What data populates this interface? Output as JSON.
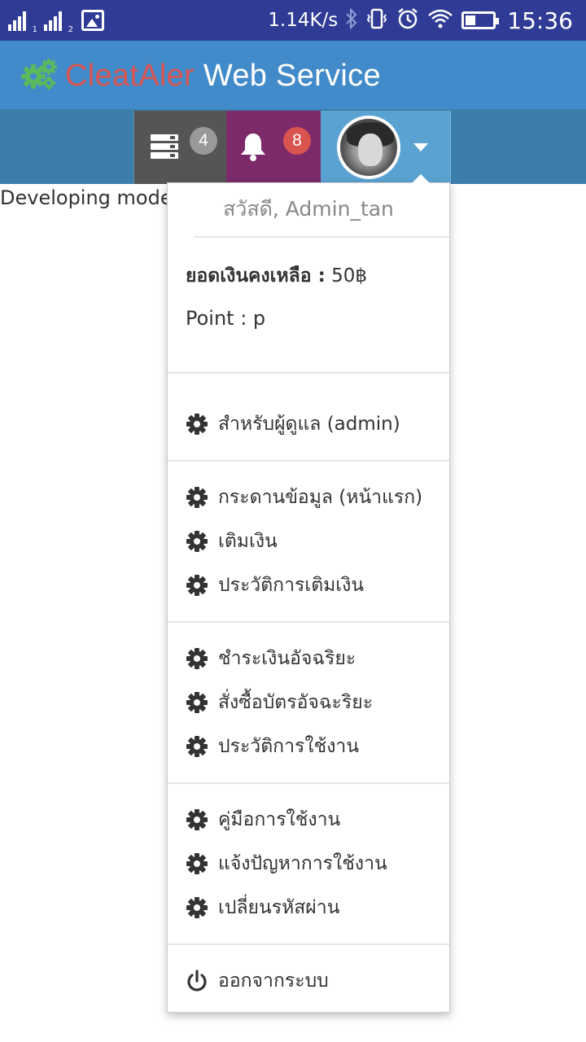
{
  "status_bar": {
    "sim1": "1",
    "sim2": "2",
    "net_speed": "1.14K/s",
    "time": "15:36",
    "icons": [
      "signal-sim1-icon",
      "signal-sim2-icon",
      "image-notification-icon",
      "bluetooth-icon",
      "vibrate-icon",
      "alarm-icon",
      "wifi-icon",
      "battery-icon"
    ]
  },
  "header": {
    "brand_part1": "CleatAler",
    "brand_part2": " Web Service",
    "colors": {
      "brand_red": "#d9534f",
      "logo_green": "#5cb85c",
      "header_bg": "#428bca"
    }
  },
  "navbar": {
    "tasks_count": "4",
    "notifications_count": "8",
    "icons": [
      "tasks-icon",
      "bell-icon",
      "avatar",
      "caret-down-icon"
    ]
  },
  "page": {
    "dev_text": "Developing mode"
  },
  "user_menu": {
    "greeting": "สวัสดี, Admin_tan",
    "balance_label": "ยอดเงินคงเหลือ :",
    "balance_value": " 50฿",
    "point_text": "Point : p",
    "groups": [
      [
        {
          "label": "สำหรับผู้ดูแล (admin)",
          "icon": "gear-icon"
        }
      ],
      [
        {
          "label": "กระดานข้อมูล (หน้าแรก)",
          "icon": "gear-icon"
        },
        {
          "label": "เติมเงิน",
          "icon": "gear-icon"
        },
        {
          "label": "ประวัติการเติมเงิน",
          "icon": "gear-icon"
        }
      ],
      [
        {
          "label": "ชำระเงินอัจฉริยะ",
          "icon": "gear-icon"
        },
        {
          "label": "สั่งซื้อบัตรอัจฉะริยะ",
          "icon": "gear-icon"
        },
        {
          "label": "ประวัติการใช้งาน",
          "icon": "gear-icon"
        }
      ],
      [
        {
          "label": "คู่มือการใช้งาน",
          "icon": "gear-icon"
        },
        {
          "label": "แจ้งปัญหาการใช้งาน",
          "icon": "gear-icon"
        },
        {
          "label": "เปลี่ยนรหัสผ่าน",
          "icon": "gear-icon"
        }
      ],
      [
        {
          "label": "ออกจากระบบ",
          "icon": "power-icon"
        }
      ]
    ]
  }
}
